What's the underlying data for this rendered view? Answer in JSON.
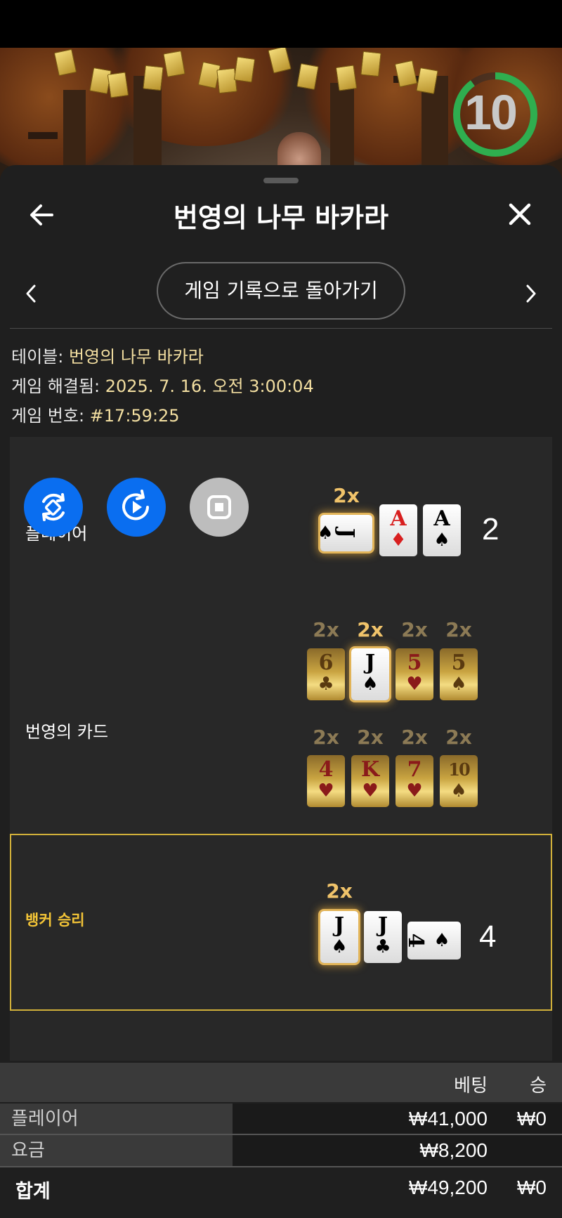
{
  "header": {
    "title": "번영의 나무 바카라",
    "back_icon": "arrow-left-icon",
    "close_icon": "close-icon"
  },
  "timer": {
    "value": "10",
    "progress": 0.9,
    "color": "#2fae4f"
  },
  "nav": {
    "back_to_history": "게임 기록으로 돌아가기",
    "prev_icon": "chevron-left-icon",
    "next_icon": "chevron-right-icon"
  },
  "info": {
    "table_label": "테이블: ",
    "table_value": "번영의 나무 바카라",
    "resolved_label": "게임 해결됨: ",
    "resolved_value": "2025. 7. 16. 오전 3:00:04",
    "game_no_label": "게임 번호: ",
    "game_no_value": "#17:59:25"
  },
  "controls": [
    {
      "icon": "sync-icon",
      "color": "#0a6ef0"
    },
    {
      "icon": "replay-icon",
      "color": "#0a6ef0"
    },
    {
      "icon": "stop-icon",
      "color": "#bdbdbd"
    }
  ],
  "player": {
    "label": "플레이어",
    "total": "2",
    "multiplier": "2x",
    "cards": [
      {
        "rank": "J",
        "suit": "♠",
        "orientation": "sideways",
        "highlighted": true
      },
      {
        "rank": "A",
        "suit": "♦",
        "color": "red"
      },
      {
        "rank": "A",
        "suit": "♠"
      }
    ]
  },
  "fortune": {
    "label": "번영의 카드",
    "row1": [
      {
        "mult": "2x",
        "rank": "6",
        "suit": "♣",
        "active": false
      },
      {
        "mult": "2x",
        "rank": "J",
        "suit": "♠",
        "active": true
      },
      {
        "mult": "2x",
        "rank": "5",
        "suit": "♥",
        "active": false,
        "color": "red"
      },
      {
        "mult": "2x",
        "rank": "5",
        "suit": "♠",
        "active": false
      }
    ],
    "row2": [
      {
        "mult": "2x",
        "rank": "4",
        "suit": "♥",
        "active": false,
        "color": "red"
      },
      {
        "mult": "2x",
        "rank": "K",
        "suit": "♥",
        "active": false,
        "color": "red"
      },
      {
        "mult": "2x",
        "rank": "7",
        "suit": "♥",
        "active": false,
        "color": "red"
      },
      {
        "mult": "2x",
        "rank": "10",
        "suit": "♠",
        "active": false
      }
    ]
  },
  "banker": {
    "label": "뱅커 승리",
    "total": "4",
    "multiplier": "2x",
    "cards": [
      {
        "rank": "J",
        "suit": "♠",
        "highlighted": true
      },
      {
        "rank": "J",
        "suit": "♣"
      },
      {
        "rank": "4",
        "suit": "♠",
        "orientation": "sideways"
      }
    ]
  },
  "bets": {
    "col_bet": "베팅",
    "col_win": "승",
    "rows": [
      {
        "name": "플레이어",
        "bet": "₩41,000",
        "win": "₩0"
      },
      {
        "name": "요금",
        "bet": "₩8,200",
        "win": ""
      }
    ],
    "total": {
      "name": "합계",
      "bet": "₩49,200",
      "win": "₩0"
    }
  },
  "colors": {
    "accent_gold": "#f0c36a",
    "banker_border": "#d1b03a",
    "blue": "#0a6ef0"
  }
}
